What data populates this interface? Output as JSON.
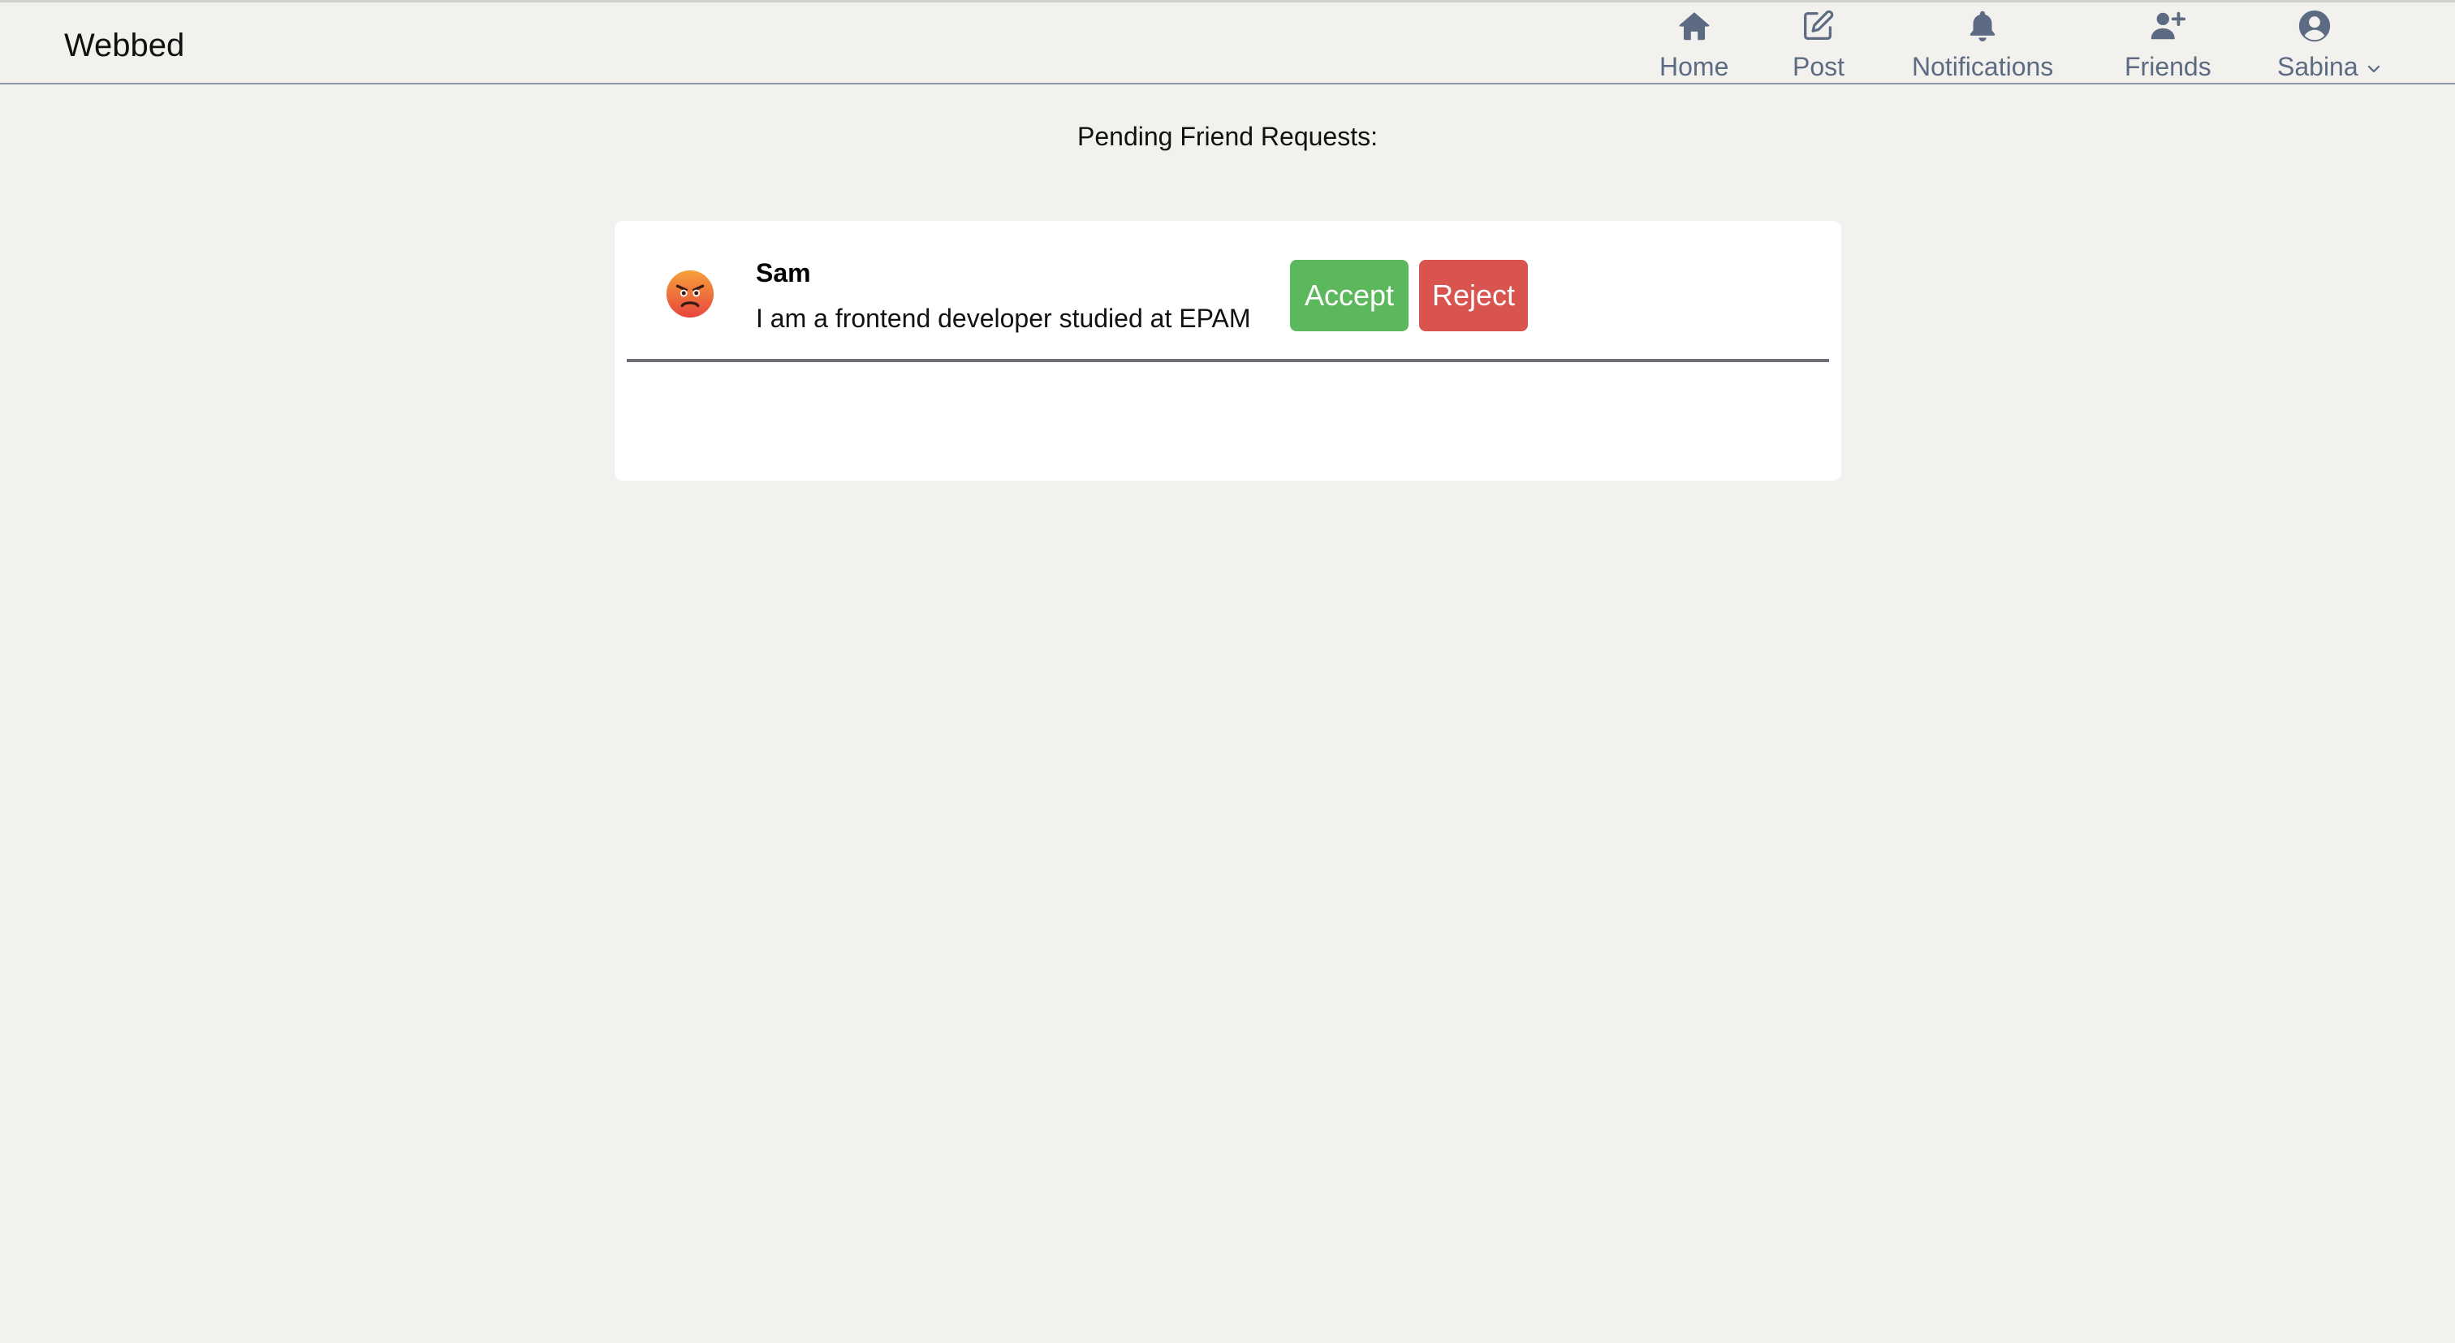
{
  "app": {
    "brand": "Webbed"
  },
  "nav": {
    "items": [
      {
        "label": "Home",
        "icon": "home-icon"
      },
      {
        "label": "Post",
        "icon": "edit-icon"
      },
      {
        "label": "Notifications",
        "icon": "bell-icon"
      },
      {
        "label": "Friends",
        "icon": "user-plus-icon"
      }
    ],
    "user": {
      "label": "Sabina",
      "icon": "user-circle-icon",
      "dropdown_icon": "chevron-down-icon"
    }
  },
  "main": {
    "heading": "Pending Friend Requests:"
  },
  "requests": [
    {
      "name": "Sam",
      "bio": "I am a frontend developer studied at EPAM",
      "avatar": "angry-face-emoji",
      "accept_label": "Accept",
      "reject_label": "Reject"
    }
  ],
  "colors": {
    "accent_accept": "#5cb85c",
    "accent_reject": "#d9534f",
    "nav_icon": "#5d6b82",
    "background": "#f2f1ee"
  }
}
